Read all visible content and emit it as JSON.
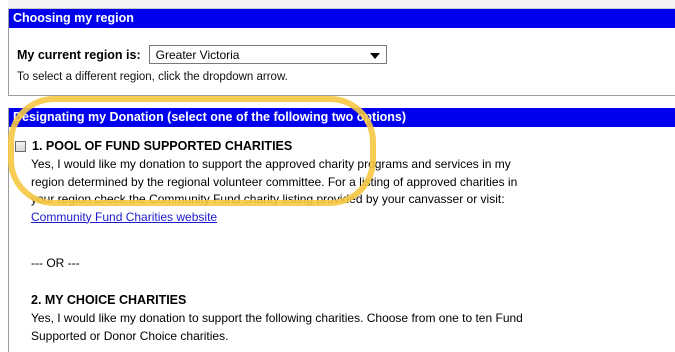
{
  "region_section": {
    "header": "Choosing my region",
    "label": "My current region is:",
    "selected_region": "Greater Victoria",
    "hint": "To select a different region, click the dropdown arrow."
  },
  "donation_section": {
    "header": "Designating my Donation (select one of the following two options)",
    "option1": {
      "title": "1. POOL OF FUND SUPPORTED CHARITIES",
      "text_line1": "Yes, I would like my donation to support the approved charity programs and services in my",
      "text_line2": "region determined by the regional volunteer committee. For a listing of approved charities in",
      "text_line3": "your region check the Community Fund charity listing provided by your canvasser or visit:",
      "link": "Community Fund Charities website",
      "checked": false
    },
    "separator": "--- OR ---",
    "option2": {
      "title": "2. MY CHOICE CHARITIES",
      "text_line1": "Yes, I would like my donation to support the following charities. Choose from one to ten Fund",
      "text_line2": "Supported or Donor Choice charities."
    }
  },
  "colors": {
    "header_bg": "#0000ee",
    "highlight": "#f6c842",
    "link": "#1a1acc"
  }
}
